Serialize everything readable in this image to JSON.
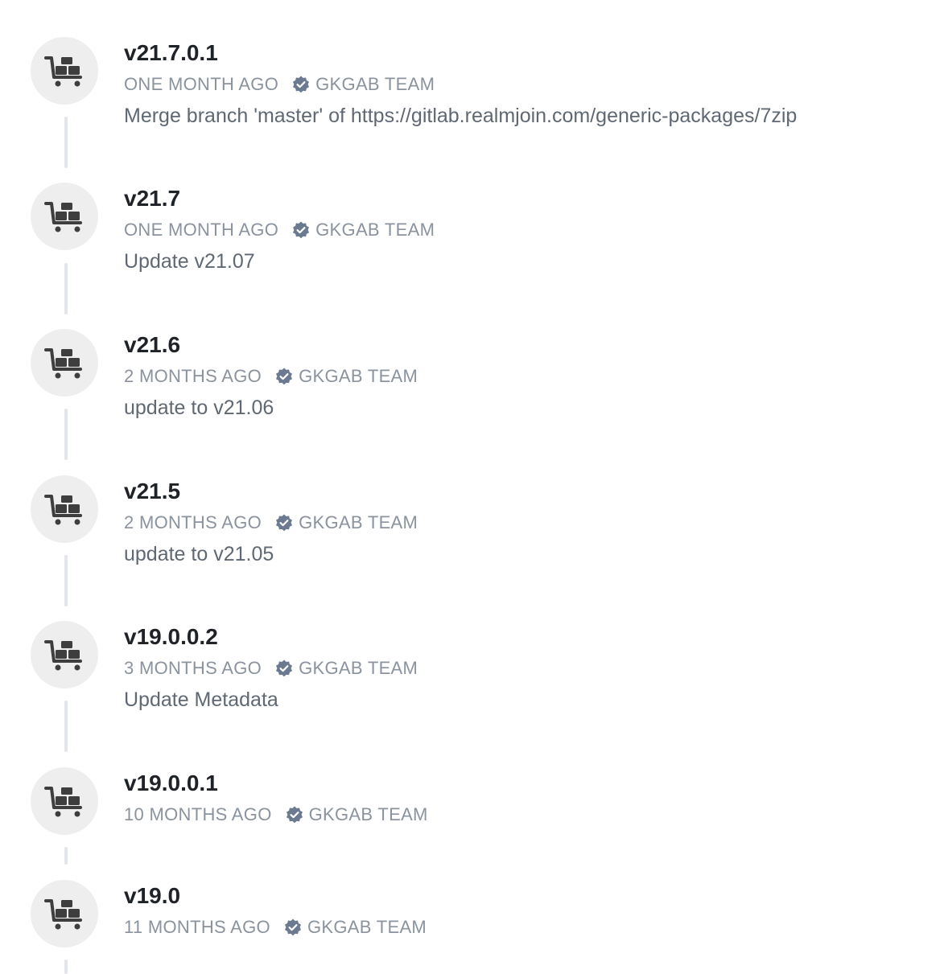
{
  "colors": {
    "title": "#1f2328",
    "meta": "#8a939e",
    "message": "#5f6873",
    "avatar_bg": "#eeeeee",
    "icon": "#3e3e3e",
    "verified_badge": "#6b7a90",
    "timeline_line": "#e2e5ea"
  },
  "releases": [
    {
      "icon": "package-cart-icon",
      "version": "v21.7.0.1",
      "time_ago": "ONE MONTH AGO",
      "author": "GKGAB TEAM",
      "author_verified": true,
      "message": "Merge branch 'master' of https://gitlab.realmjoin.com/generic-packages/7zip"
    },
    {
      "icon": "package-cart-icon",
      "version": "v21.7",
      "time_ago": "ONE MONTH AGO",
      "author": "GKGAB TEAM",
      "author_verified": true,
      "message": "Update v21.07"
    },
    {
      "icon": "package-cart-icon",
      "version": "v21.6",
      "time_ago": "2 MONTHS AGO",
      "author": "GKGAB TEAM",
      "author_verified": true,
      "message": "update to v21.06"
    },
    {
      "icon": "package-cart-icon",
      "version": "v21.5",
      "time_ago": "2 MONTHS AGO",
      "author": "GKGAB TEAM",
      "author_verified": true,
      "message": "update to v21.05"
    },
    {
      "icon": "package-cart-icon",
      "version": "v19.0.0.2",
      "time_ago": "3 MONTHS AGO",
      "author": "GKGAB TEAM",
      "author_verified": true,
      "message": "Update Metadata"
    },
    {
      "icon": "package-cart-icon",
      "version": "v19.0.0.1",
      "time_ago": "10 MONTHS AGO",
      "author": "GKGAB TEAM",
      "author_verified": true,
      "message": ""
    },
    {
      "icon": "package-cart-icon",
      "version": "v19.0",
      "time_ago": "11 MONTHS AGO",
      "author": "GKGAB TEAM",
      "author_verified": true,
      "message": ""
    }
  ]
}
